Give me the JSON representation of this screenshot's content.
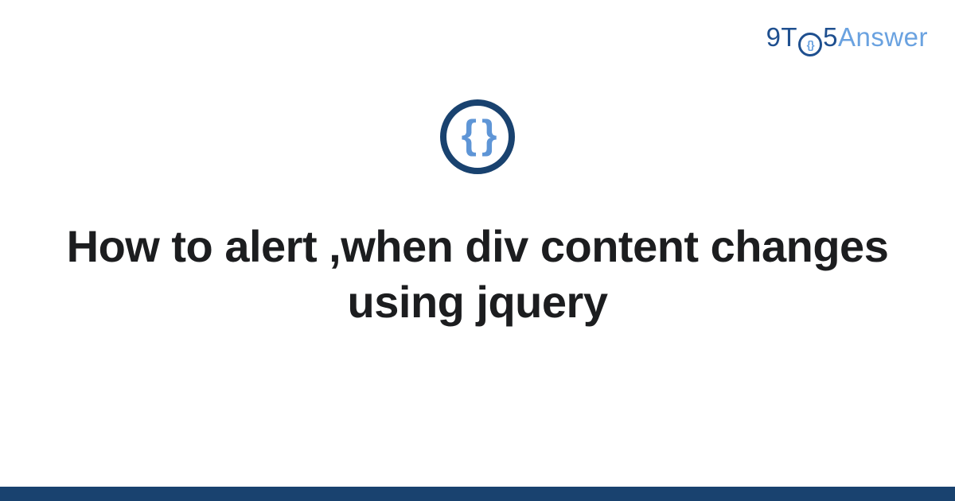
{
  "brand": {
    "prefix": "9T",
    "circle_glyph": "{}",
    "mid": "5",
    "suffix": "Answer"
  },
  "center_icon": {
    "glyph": "{ }",
    "semantic": "code-braces-icon"
  },
  "title": "How to alert ,when div content changes using jquery",
  "colors": {
    "brand_dark": "#19426f",
    "brand_mid": "#1e4f8f",
    "brand_light": "#6aa2e0",
    "text": "#1c1d1f"
  }
}
